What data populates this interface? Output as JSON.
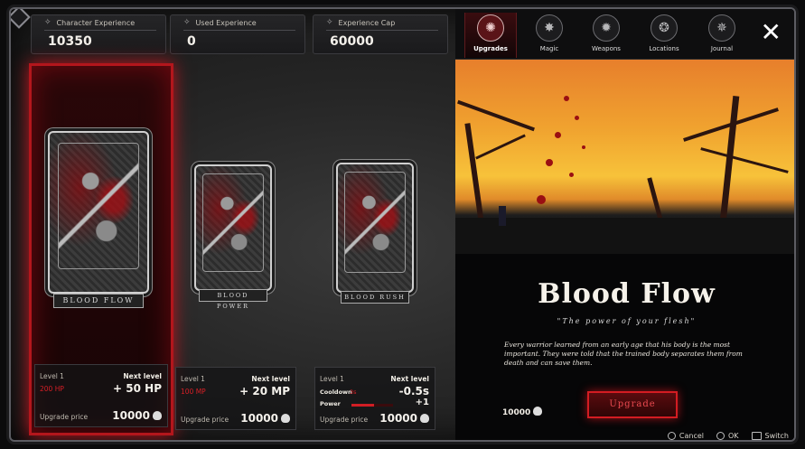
{
  "stats": [
    {
      "label": "Character Experience",
      "value": "10350",
      "icon": "sparkle-icon"
    },
    {
      "label": "Used Experience",
      "value": "0",
      "icon": "sparkle-icon"
    },
    {
      "label": "Experience Cap",
      "value": "60000",
      "icon": "sparkle-icon"
    }
  ],
  "tabs": [
    {
      "label": "Upgrades",
      "glyph": "✺",
      "active": true
    },
    {
      "label": "Magic",
      "glyph": "✸"
    },
    {
      "label": "Weapons",
      "glyph": "✹"
    },
    {
      "label": "Locations",
      "glyph": "❂"
    },
    {
      "label": "Journal",
      "glyph": "✵"
    }
  ],
  "close_glyph": "✕",
  "cards": [
    {
      "name": "BLOOD FLOW",
      "level_label": "Level 1",
      "next_label": "Next level",
      "current_value": "200 HP",
      "next_value": "+ 50 HP",
      "price_label": "Upgrade price",
      "price": "10000"
    },
    {
      "name": "BLOOD POWER",
      "level_label": "Level 1",
      "next_label": "Next level",
      "current_value": "100 MP",
      "next_value": "+ 20 MP",
      "price_label": "Upgrade price",
      "price": "10000"
    },
    {
      "name": "BLOOD RUSH",
      "level_label": "Level 1",
      "next_label": "Next level",
      "cooldown_label": "Cooldown",
      "cooldown_value": "3s",
      "cooldown_next": "-0.5s",
      "power_label": "Power",
      "power_fill": 0.55,
      "power_next": "+1",
      "price_label": "Upgrade price",
      "price": "10000"
    }
  ],
  "detail": {
    "title": "Blood Flow",
    "subtitle": "\"The power of your flesh\"",
    "description": "Every warrior learned from an early age that his body is the most important. They were told that the trained body separates them from death and can save them.",
    "price": "10000",
    "upgrade_label": "Upgrade"
  },
  "hints": [
    {
      "label": "Cancel",
      "icon": "circle-button-icon"
    },
    {
      "label": "OK",
      "icon": "cross-button-icon"
    },
    {
      "label": "Switch",
      "icon": "bumper-button-icon"
    }
  ],
  "colors": {
    "accent": "#d31c22",
    "selected_glow": "#b3161c"
  }
}
